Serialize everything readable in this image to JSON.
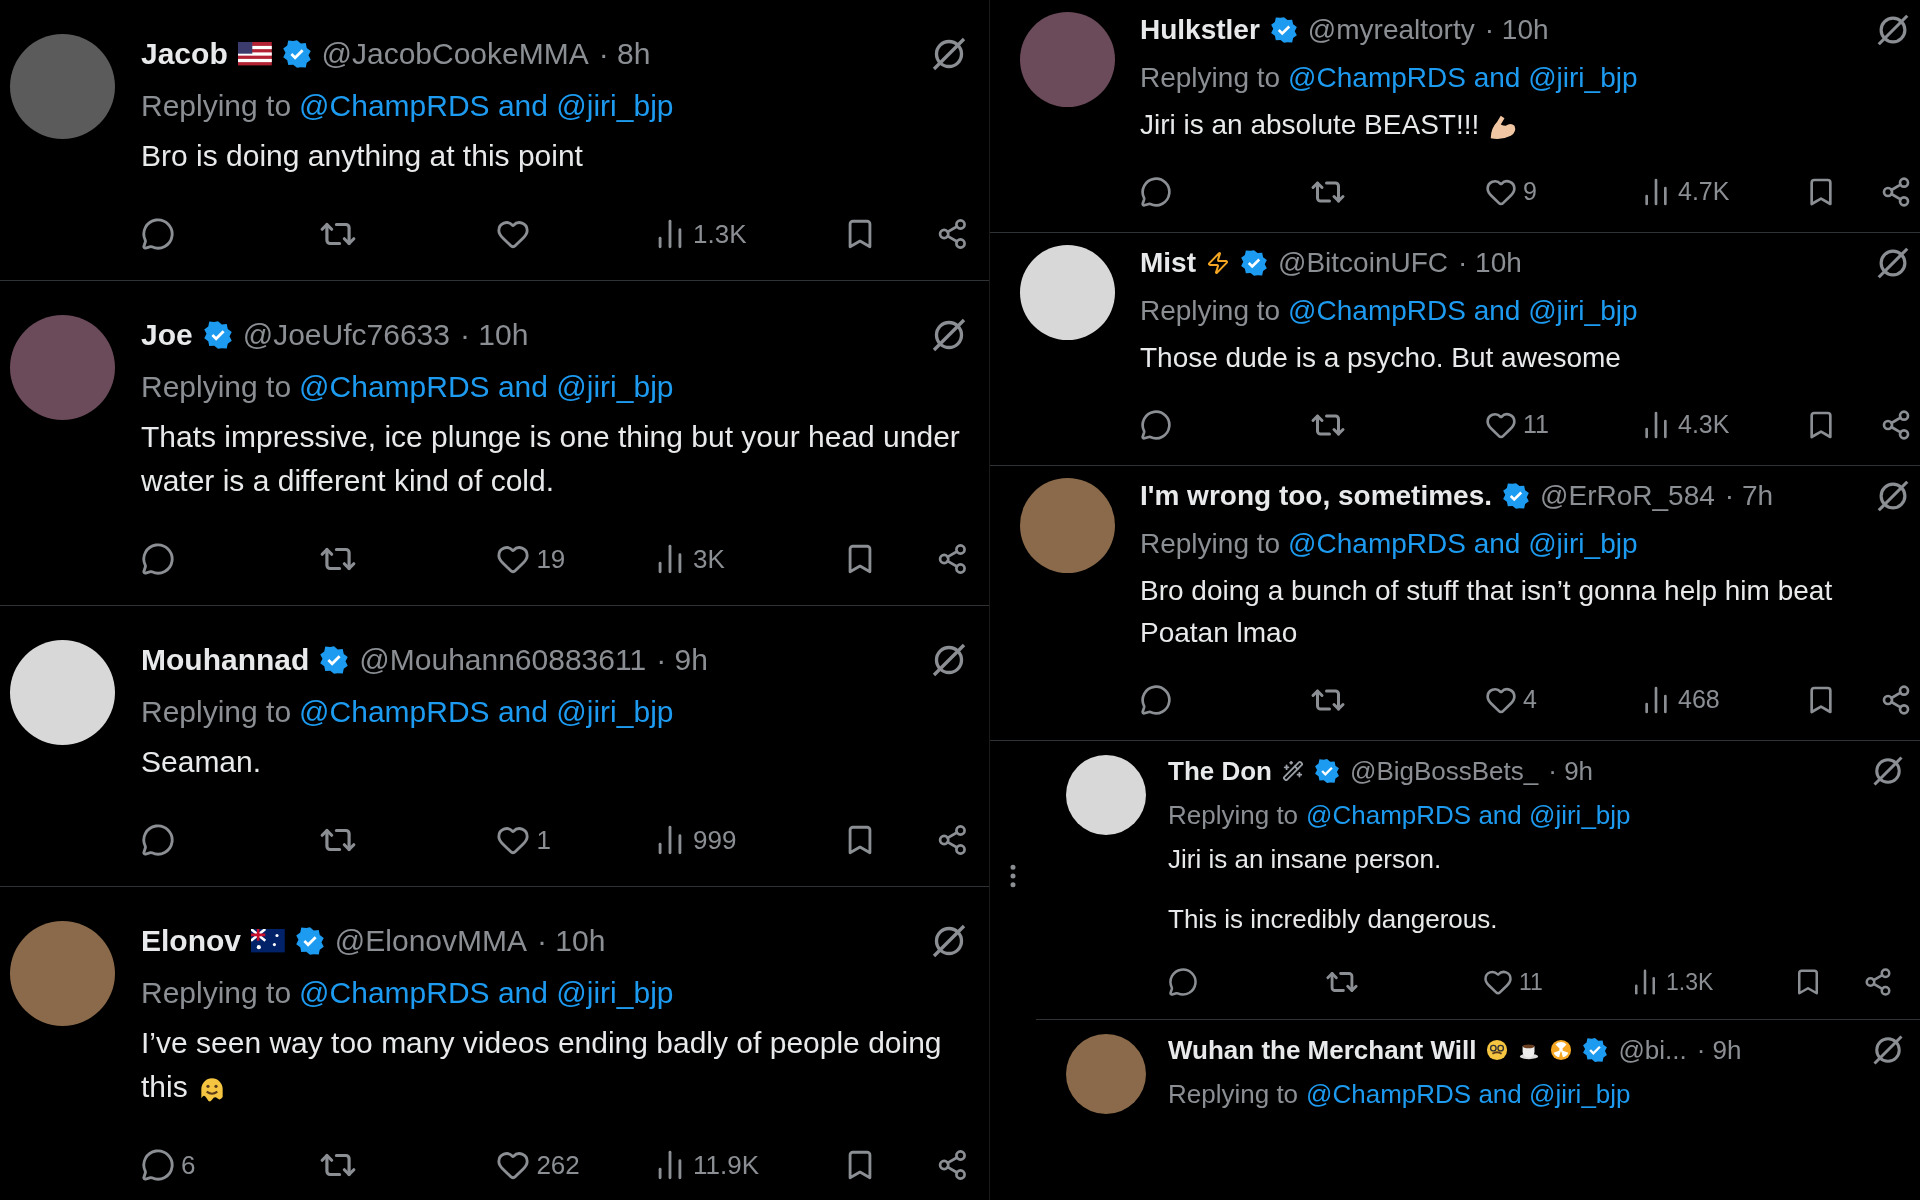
{
  "left_column": {
    "tweets": [
      {
        "name": "Jacob",
        "decor": [
          {
            "kind": "us-flag"
          }
        ],
        "verified": true,
        "handle": "@JacobCookeMMA",
        "time": "· 8h",
        "replying_prefix": "Replying to",
        "replying_to": "@ChampRDS and @jiri_bjp",
        "body": [
          "Bro is doing anything at this point"
        ],
        "stats": {
          "views": "1.3K"
        }
      },
      {
        "name": "Joe",
        "verified": true,
        "handle": "@JoeUfc76633",
        "time": "· 10h",
        "replying_prefix": "Replying to",
        "replying_to": "@ChampRDS and @jiri_bjp",
        "body": [
          "Thats impressive, ice plunge is one thing but your head under water is a different kind of cold."
        ],
        "stats": {
          "likes": "19",
          "views": "3K"
        }
      },
      {
        "name": "Mouhannad",
        "verified": true,
        "handle": "@Mouhann60883611",
        "time": "· 9h",
        "replying_prefix": "Replying to",
        "replying_to": "@ChampRDS and @jiri_bjp",
        "body": [
          "Seaman."
        ],
        "stats": {
          "likes": "1",
          "views": "999"
        }
      },
      {
        "name": "Elonov",
        "decor": [
          {
            "kind": "au-flag"
          }
        ],
        "verified": true,
        "handle": "@ElonovMMA",
        "time": "· 10h",
        "replying_prefix": "Replying to",
        "replying_to": "@ChampRDS and @jiri_bjp",
        "body": [
          "I’ve seen way too many videos ending badly of people doing this"
        ],
        "body_icon": {
          "kind": "melting-face"
        },
        "stats": {
          "replies": "6",
          "likes": "262",
          "views": "11.9K"
        }
      }
    ]
  },
  "right_column": {
    "tweets": [
      {
        "name": "Hulkstler",
        "verified": true,
        "handle": "@myrealtorty",
        "time": "· 10h",
        "replying_prefix": "Replying to",
        "replying_to": "@ChampRDS and @jiri_bjp",
        "body": [
          "Jiri is an absolute BEAST!!!"
        ],
        "body_icon": {
          "kind": "flexed-arm"
        },
        "stats": {
          "likes": "9",
          "views": "4.7K"
        }
      },
      {
        "name": "Mist",
        "decor": [
          {
            "kind": "lightning"
          }
        ],
        "verified": true,
        "handle": "@BitcoinUFC",
        "time": "· 10h",
        "replying_prefix": "Replying to",
        "replying_to": "@ChampRDS and @jiri_bjp",
        "body": [
          "Those dude is a psycho. But awesome"
        ],
        "stats": {
          "likes": "11",
          "views": "4.3K"
        }
      },
      {
        "name": "I'm wrong too, sometimes.",
        "verified": true,
        "handle": "@ErRoR_584",
        "time": "· 7h",
        "replying_prefix": "Replying to",
        "replying_to": "@ChampRDS and @jiri_bjp",
        "body": [
          "Bro doing a bunch of stuff that isn’t gonna help him beat Poatan lmao"
        ],
        "stats": {
          "likes": "4",
          "views": "468"
        }
      }
    ],
    "lower_panel": {
      "tweets": [
        {
          "name": "The Don",
          "decor": [
            {
              "kind": "wand"
            }
          ],
          "verified": true,
          "handle": "@BigBossBets_",
          "time": "· 9h",
          "replying_prefix": "Replying to",
          "replying_to": "@ChampRDS and @jiri_bjp",
          "body": [
            "Jiri is an insane person.",
            "This is incredibly dangerous."
          ],
          "stats": {
            "likes": "11",
            "views": "1.3K"
          }
        },
        {
          "name": "Wuhan the Merchant Will",
          "decor": [
            {
              "kind": "disguise-face"
            },
            {
              "kind": "coffee"
            },
            {
              "kind": "radioactive"
            }
          ],
          "verified": true,
          "handle": "@bi...",
          "time": "· 9h",
          "replying_prefix": "Replying to",
          "replying_to": "@ChampRDS and @jiri_bjp"
        }
      ]
    }
  }
}
